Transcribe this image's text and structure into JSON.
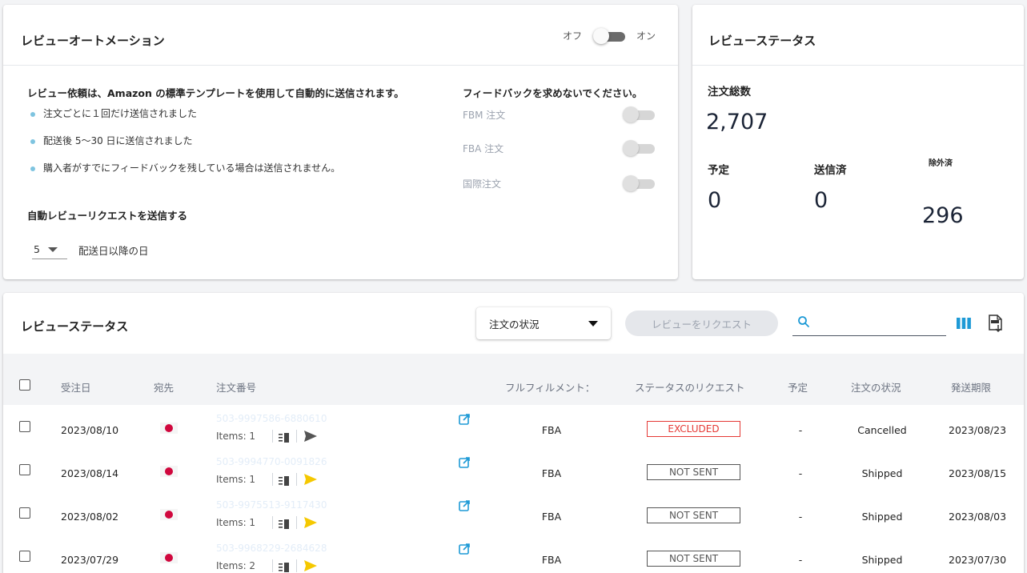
{
  "automation": {
    "title": "レビューオートメーション",
    "toggle_off": "オフ",
    "toggle_on": "オン",
    "info_heading": "レビュー依頼は、Amazon の標準テンプレートを使用して自動的に送信されます。",
    "bullets": [
      "注文ごとに１回だけ送信されました",
      "配送後 5〜30 日に送信されました",
      "購入者がすでにフィードバックを残している場合は送信されません。"
    ],
    "auto_request_label": "自動レビューリクエストを送信する",
    "days_value": "5",
    "days_suffix": "配送日以降の日",
    "feedback_heading": "フィードバックを求めないでください。",
    "feedback_options": [
      "FBM 注文",
      "FBA 注文",
      "国際注文"
    ]
  },
  "summary": {
    "title": "レビューステータス",
    "total_label": "注文総数",
    "total_value": "2,707",
    "scheduled_label": "予定",
    "scheduled_value": "0",
    "sent_label": "送信済",
    "sent_value": "0",
    "excluded_label": "除外済",
    "excluded_value": "296"
  },
  "table": {
    "title": "レビューステータス",
    "order_status_select": "注文の状況",
    "request_button": "レビューをリクエスト",
    "search_placeholder": "",
    "headers": {
      "order_date": "受注日",
      "destination": "宛先",
      "order_number": "注文番号",
      "fulfillment": "フルフィルメント：",
      "request_status": "ステータスのリクエスト",
      "scheduled": "予定",
      "order_status": "注文の状況",
      "ship_deadline": "発送期限"
    },
    "rows": [
      {
        "date": "2023/08/10",
        "order_id": "503-9997586-6880610",
        "items": "Items: 1",
        "fulfillment": "FBA",
        "status": "EXCLUDED",
        "scheduled": "-",
        "order_status": "Cancelled",
        "deadline": "2023/08/23"
      },
      {
        "date": "2023/08/14",
        "order_id": "503-9994770-0091826",
        "items": "Items: 1",
        "fulfillment": "FBA",
        "status": "NOT SENT",
        "scheduled": "-",
        "order_status": "Shipped",
        "deadline": "2023/08/15"
      },
      {
        "date": "2023/08/02",
        "order_id": "503-9975513-9117430",
        "items": "Items: 1",
        "fulfillment": "FBA",
        "status": "NOT SENT",
        "scheduled": "-",
        "order_status": "Shipped",
        "deadline": "2023/08/03"
      },
      {
        "date": "2023/07/29",
        "order_id": "503-9968229-2684628",
        "items": "Items: 2",
        "fulfillment": "FBA",
        "status": "NOT SENT",
        "scheduled": "-",
        "order_status": "Shipped",
        "deadline": "2023/07/30"
      }
    ]
  },
  "colors": {
    "accent_blue": "#1e9ad6",
    "send_yellow": "#f5c800",
    "send_gray": "#555555",
    "excluded_red": "#e53935",
    "flag_red": "#d0073d"
  },
  "icons": {
    "search": "search-icon",
    "columns": "columns-icon",
    "export": "export-csv-icon",
    "external_link": "external-link-icon",
    "details": "details-icon",
    "send": "send-icon",
    "flag": "japan-flag-icon"
  }
}
